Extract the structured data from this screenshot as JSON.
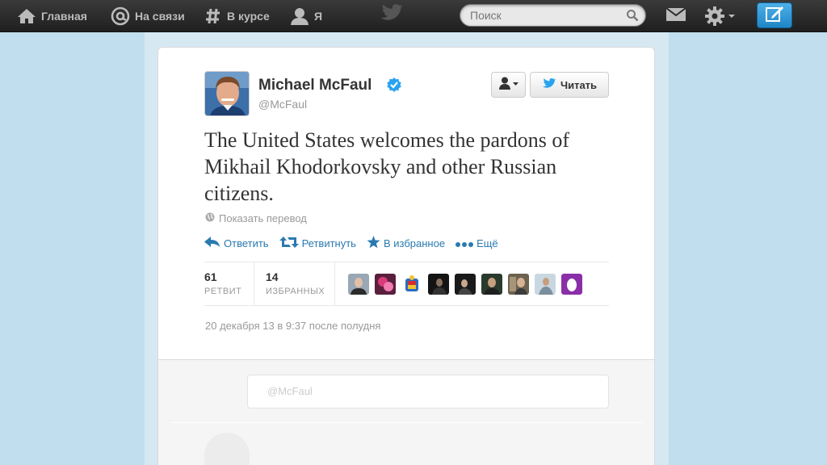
{
  "topbar": {
    "home_label": "Главная",
    "connect_label": "На связи",
    "discover_label": "В курсе",
    "me_label": "Я",
    "search_placeholder": "Поиск"
  },
  "tweet": {
    "author_name": "Michael McFaul",
    "author_handle": "@McFaul",
    "verified": true,
    "follow_label": "Читать",
    "text": "The United States welcomes the pardons of Mikhail Khodorkovsky and other Russian citizens.",
    "translate_label": "Показать перевод",
    "actions": {
      "reply": "Ответить",
      "retweet": "Ретвитнуть",
      "favorite": "В избранное",
      "more": "Ещё"
    },
    "stats": {
      "retweets_count": "61",
      "retweets_label": "РЕТВИТ",
      "favorites_count": "14",
      "favorites_label": "ИЗБРАННЫХ"
    },
    "favoriter_avatars": 9,
    "timestamp": "20 декабря 13 в 9:37 после полудня"
  },
  "reply": {
    "placeholder": "@McFaul"
  },
  "colors": {
    "background": "#c0deed",
    "link": "#2a7ab0",
    "verified": "#2aa3ef",
    "compose": "#1f86c7"
  }
}
